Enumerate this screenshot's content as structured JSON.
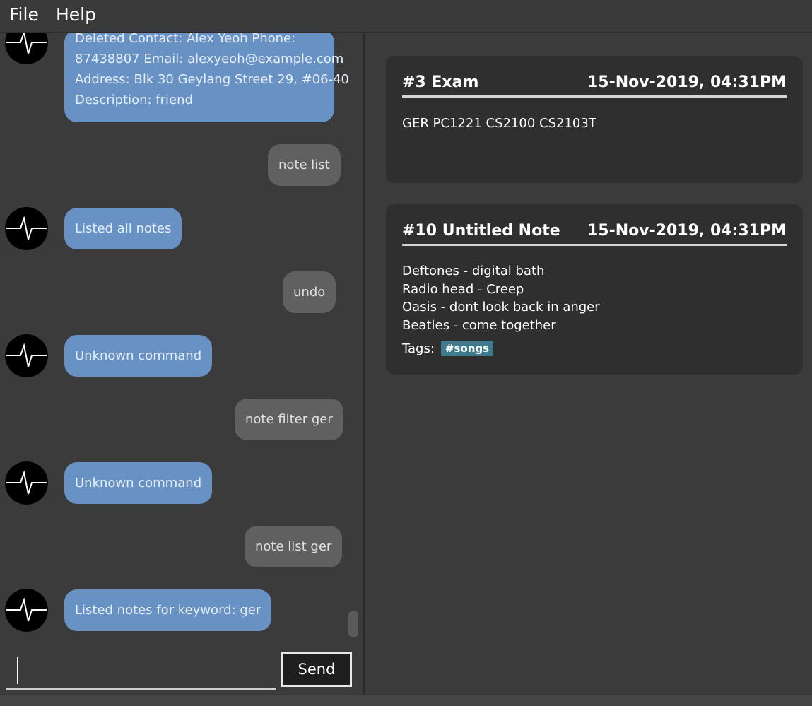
{
  "menu": {
    "file": "File",
    "help": "Help"
  },
  "chat": {
    "messages": [
      {
        "role": "bot",
        "lines": [
          "Deleted Contact: Alex Yeoh Phone:",
          "87438807 Email: alexyeoh@example.com",
          "Address: Blk 30 Geylang Street 29, #06-40",
          "Description: friend"
        ]
      },
      {
        "role": "user",
        "text": "note list"
      },
      {
        "role": "bot",
        "text": "Listed all notes"
      },
      {
        "role": "user",
        "text": "undo"
      },
      {
        "role": "bot",
        "text": "Unknown command"
      },
      {
        "role": "user",
        "text": "note filter ger"
      },
      {
        "role": "bot",
        "text": "Unknown command"
      },
      {
        "role": "user",
        "text": "note list ger"
      },
      {
        "role": "bot",
        "text": "Listed notes for keyword: ger"
      }
    ],
    "input_value": "",
    "send_label": "Send"
  },
  "notes": [
    {
      "title": "#3  Exam",
      "date": "15-Nov-2019, 04:31PM",
      "lines": [
        "GER PC1221 CS2100 CS2103T"
      ],
      "tags": []
    },
    {
      "title": "#10  Untitled Note",
      "date": "15-Nov-2019, 04:31PM",
      "lines": [
        "Deftones - digital bath",
        "Radio head - Creep",
        "Oasis - dont look back in anger",
        "Beatles - come together"
      ],
      "tags_label": "Tags:",
      "tags": [
        "#songs"
      ]
    }
  ],
  "colors": {
    "bot_bubble": "#6892c4",
    "user_bubble": "#606060",
    "tag": "#3c7a8c",
    "card": "#2f2f2f"
  }
}
